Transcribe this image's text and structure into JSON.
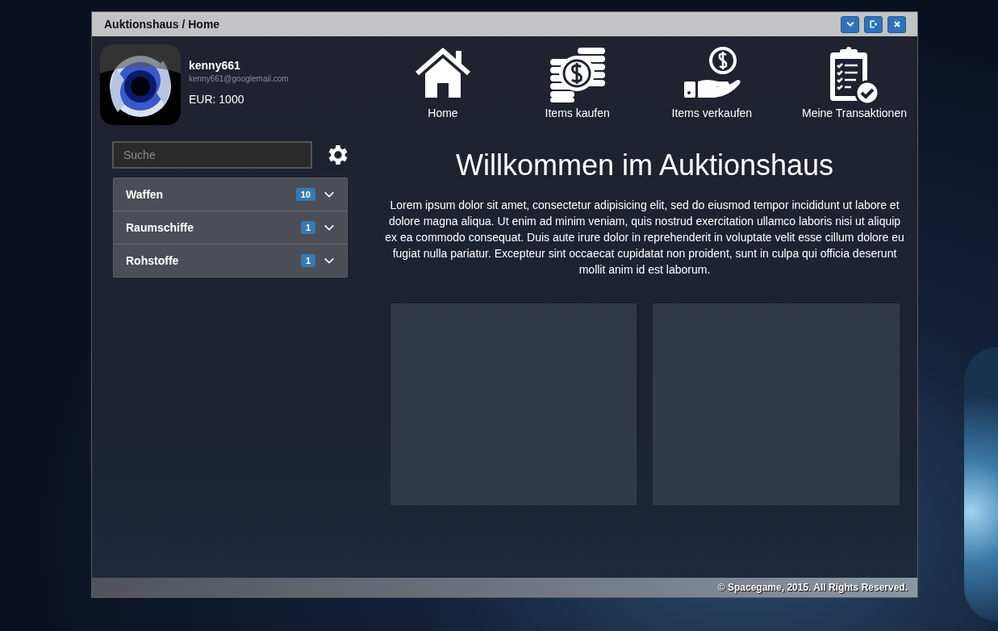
{
  "window": {
    "title": "Auktionshaus / Home",
    "controls": [
      {
        "kind": "collapse"
      },
      {
        "kind": "logout"
      },
      {
        "kind": "close"
      }
    ]
  },
  "user": {
    "name": "kenny661",
    "email": "kenny661@googlemail.com",
    "balance": "EUR: 1000"
  },
  "search": {
    "placeholder": "Suche"
  },
  "categories": [
    {
      "label": "Waffen",
      "count": "10",
      "expanded": false
    },
    {
      "label": "Raumschiffe",
      "count": "1",
      "expanded": false
    },
    {
      "label": "Rohstoffe",
      "count": "1",
      "expanded": false
    }
  ],
  "nav": [
    {
      "kind": "home",
      "label": "Home"
    },
    {
      "kind": "buy",
      "label": "Items kaufen"
    },
    {
      "kind": "sell",
      "label": "Items verkaufen"
    },
    {
      "kind": "transactions",
      "label": "Meine Transaktionen"
    }
  ],
  "heading": "Willkommen im Auktionshaus",
  "intro": "Lorem ipsum dolor sit amet, consectetur adipisicing elit, sed do eiusmod tempor incididunt ut labore et dolore magna aliqua. Ut enim ad minim veniam, quis nostrud exercitation ullamco laboris nisi ut aliquip ex ea commodo consequat. Duis aute irure dolor in reprehenderit in voluptate velit esse cillum dolore eu fugiat nulla pariatur. Excepteur sint occaecat cupidatat non proident, sunt in culpa qui officia deserunt mollit anim id est laborum.",
  "panels": [
    {
      "kind": "empty"
    },
    {
      "kind": "empty"
    }
  ],
  "footer": "© Spacegame, 2015. All Rights Reserved."
}
